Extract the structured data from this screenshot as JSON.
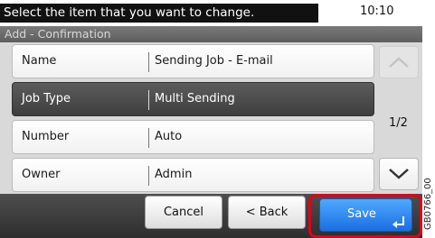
{
  "header": {
    "message": "Select the item that you want to change.",
    "clock": "10:10",
    "screen_title": "Add - Confirmation"
  },
  "rows": [
    {
      "label": "Name",
      "value": "Sending Job - E-mail"
    },
    {
      "label": "Job Type",
      "value": "Multi Sending"
    },
    {
      "label": "Number",
      "value": "Auto"
    },
    {
      "label": "Owner",
      "value": "Admin"
    }
  ],
  "selected_row": 1,
  "pager": {
    "text": "1/2"
  },
  "icons": {
    "up": "chevron-up-icon",
    "down": "chevron-down-icon",
    "enter": "enter-icon"
  },
  "buttons": {
    "cancel": "Cancel",
    "back": "< Back",
    "save": "Save"
  },
  "stamp": "GB0766_00",
  "colors": {
    "save": "#2a83f0",
    "highlight": "#e0001a"
  }
}
